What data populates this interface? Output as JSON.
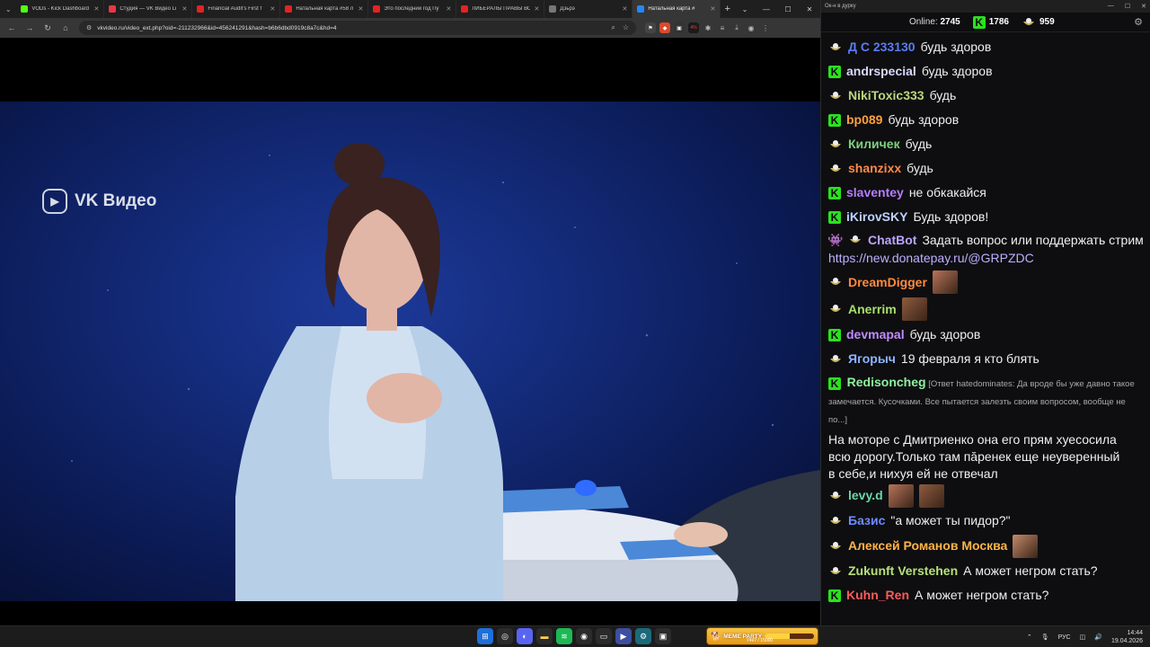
{
  "browser": {
    "tabs": [
      {
        "title": "VODs - Kick Dashboard",
        "icon": "kick-icon",
        "color": "#53fc18",
        "active": false
      },
      {
        "title": "Студия — VK Видео Li",
        "icon": "vk-studio-icon",
        "color": "#e63946",
        "active": false
      },
      {
        "title": "Financial Audit's First f",
        "icon": "youtube-icon",
        "color": "#e02424",
        "active": false
      },
      {
        "title": "Натальная карта #58 л",
        "icon": "youtube-icon",
        "color": "#e02424",
        "active": false
      },
      {
        "title": "Это последний год Пу",
        "icon": "youtube-icon",
        "color": "#e02424",
        "active": false
      },
      {
        "title": "ЛИБЕРАЛЫ ПРАВЫ ВО",
        "icon": "youtube-icon",
        "color": "#e02424",
        "active": false
      },
      {
        "title": "Дзьрэ",
        "icon": "page-icon",
        "color": "#777777",
        "active": false
      },
      {
        "title": "Натальная карта #",
        "icon": "vk-video-icon",
        "color": "#2787f5",
        "active": true
      }
    ],
    "url": "vkvideo.ru/video_ext.php?oid=-211232966&id=456241291&hash=b6b6dbd0919c8a7c&hd=4",
    "ext_badge": "4%"
  },
  "video": {
    "watermark": "VK Видео"
  },
  "chat": {
    "window_title": "Ок-н в дурку",
    "online_label": "Online:",
    "online_count": "2745",
    "kick_count": "1786",
    "twitch_count": "959",
    "messages": [
      {
        "platform": "twitch",
        "user": "Д С 233130",
        "color": "#5b7bf2",
        "text": "будь здоров"
      },
      {
        "platform": "kick",
        "user": "andrspecial",
        "color": "#d8d8ff",
        "text": "будь здоров"
      },
      {
        "platform": "twitch",
        "user": "NikiToxic333",
        "color": "#b9d77a",
        "text": "будь"
      },
      {
        "platform": "kick",
        "user": "bp089",
        "color": "#ff9f40",
        "text": "будь здоров"
      },
      {
        "platform": "twitch",
        "user": "Киличек",
        "color": "#7bd27b",
        "text": "будь"
      },
      {
        "platform": "twitch",
        "user": "shanzixx",
        "color": "#ff8a4a",
        "text": "будь"
      },
      {
        "platform": "kick",
        "user": "slaventey",
        "color": "#b57cff",
        "text": "не обкакайся"
      },
      {
        "platform": "kick",
        "user": "iKirovSKY",
        "color": "#bcd2ff",
        "text": "Будь здоров!"
      },
      {
        "platform": "twitch",
        "user": "DreamDigger",
        "color": "#ff8a3d",
        "text": "",
        "emotes": 1
      },
      {
        "platform": "twitch",
        "user": "Anerrim",
        "color": "#a8e06a",
        "text": "",
        "emotes": 1
      },
      {
        "platform": "kick",
        "user": "devmapal",
        "color": "#c08cff",
        "text": "будь здоров"
      },
      {
        "platform": "twitch",
        "user": "Ягорыч",
        "color": "#8fb3ff",
        "text": "19 февраля я кто блять"
      }
    ],
    "bot": {
      "user": "ChatBot",
      "color": "#bda4ff",
      "text": "Задать вопрос или поддержать стримера:",
      "link": "https://new.donatepay.ru/@GRPZDC"
    },
    "reply_message": {
      "user": "Redisoncheg",
      "color": "#8ef0a0",
      "reply": "[Ответ hatedominates: Да вроде бы уже давно такое замечается. Кусочками. Все пытается залезть своим вопросом, вообще не по...]",
      "text_lines": [
        "На моторе с Дмитриенко она его прям хуесосила",
        "всю дорогу.Только там пăренек еще неуверенный",
        "в себе,и нихуя ей не отвечал"
      ]
    },
    "tail_messages": [
      {
        "platform": "twitch",
        "user": "levy.d",
        "color": "#6ad7a8",
        "text": "",
        "emotes": 2
      },
      {
        "platform": "twitch",
        "user": "Базис",
        "color": "#6f8cff",
        "text": "\"а может ты пидор?\""
      },
      {
        "platform": "twitch",
        "user": "Алексей Романов Москва",
        "color": "#ffb347",
        "text": "",
        "emotes": 1
      },
      {
        "platform": "twitch",
        "user": "Zukunft Verstehen",
        "color": "#b7e07a",
        "text": "А может негром стать?"
      },
      {
        "platform": "kick",
        "user": "Kuhn_Ren",
        "color": "#ff5b5b",
        "text": "А может негром стать?"
      }
    ]
  },
  "taskbar": {
    "widget_title": "MEME PARTY",
    "widget_count": "7497 / 15000",
    "widget_progress": 0.5,
    "lang": "РУС",
    "time": "14:44",
    "date": "19.04.2026"
  }
}
